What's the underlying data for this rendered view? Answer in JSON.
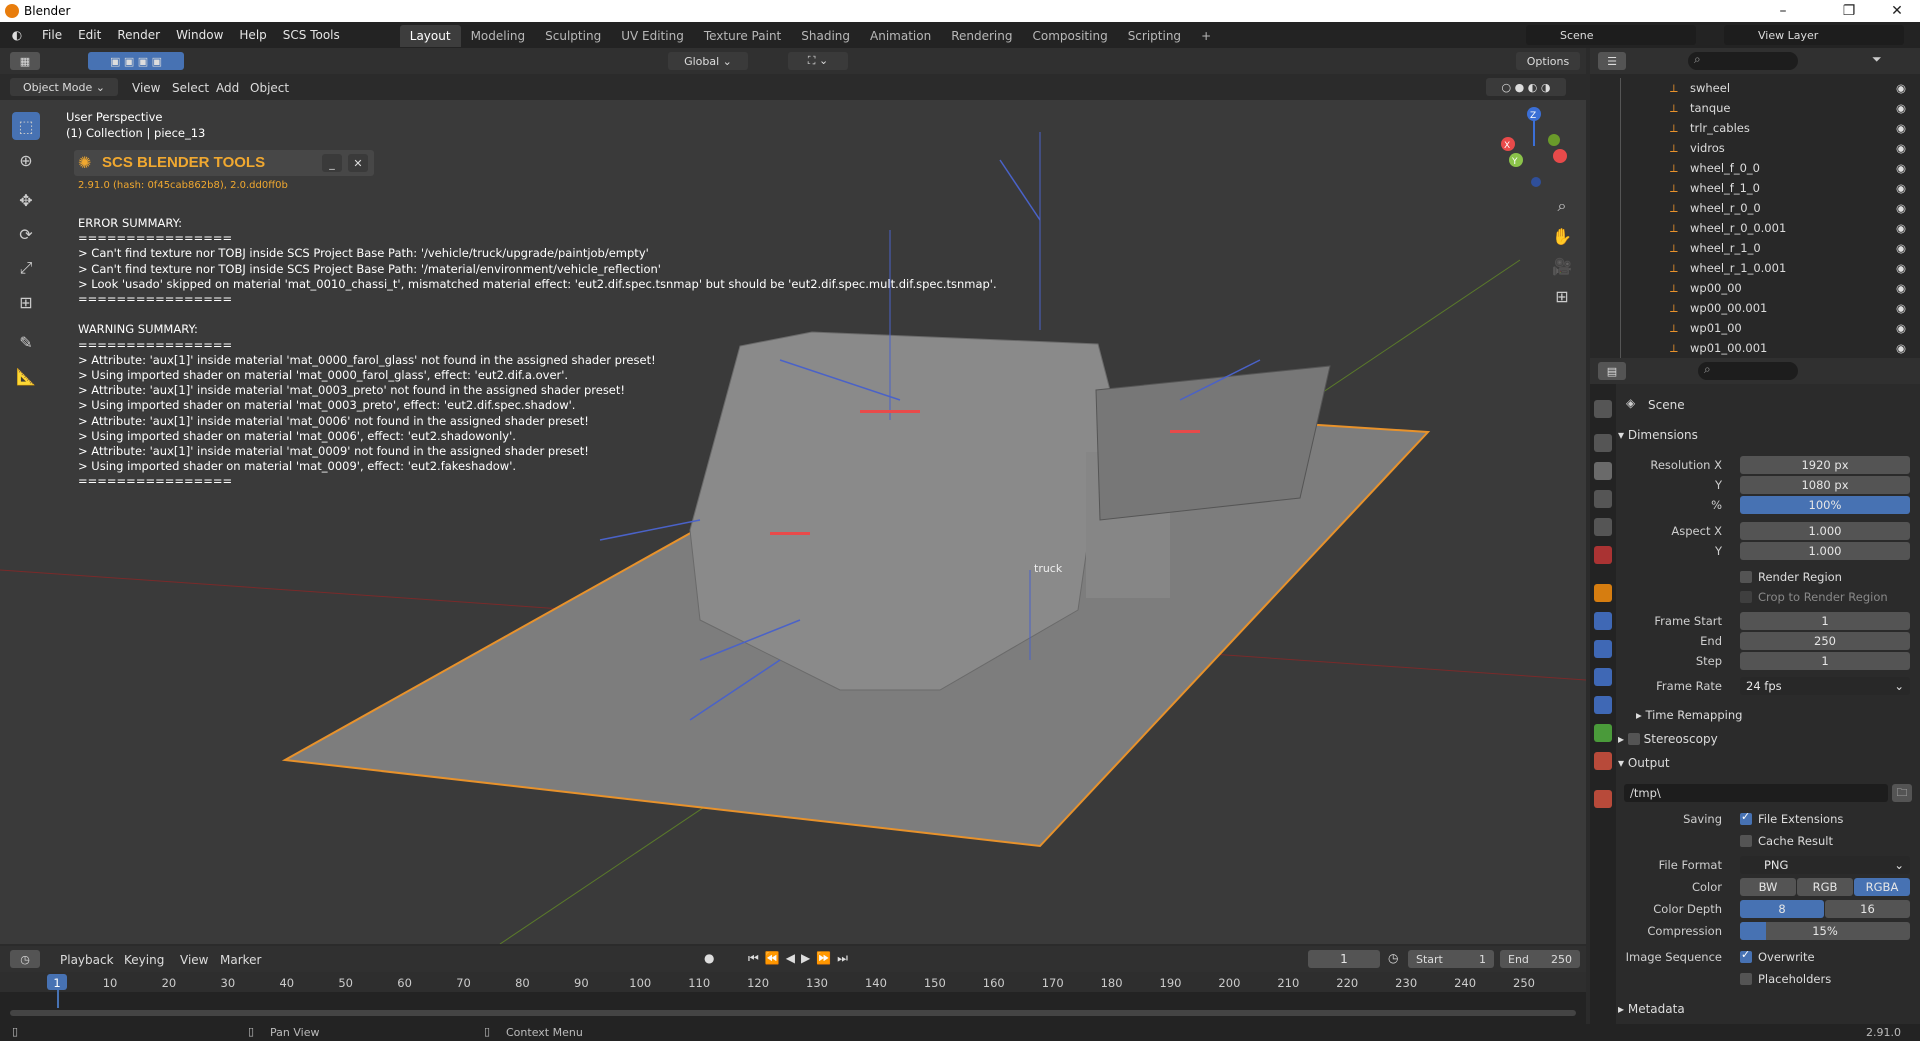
{
  "window": {
    "title": "Blender"
  },
  "menu": [
    "File",
    "Edit",
    "Render",
    "Window",
    "Help",
    "SCS Tools"
  ],
  "workspaces": [
    "Layout",
    "Modeling",
    "Sculpting",
    "UV Editing",
    "Texture Paint",
    "Shading",
    "Animation",
    "Rendering",
    "Compositing",
    "Scripting"
  ],
  "scene_field": "Scene",
  "view_layer_field": "View Layer",
  "viewport": {
    "mode": "Object Mode",
    "menus": [
      "View",
      "Select",
      "Add",
      "Object"
    ],
    "orientation": "Global",
    "options": "Options",
    "perspective": "User Perspective",
    "collection": "(1) Collection | piece_13",
    "object_label": "truck",
    "gizmo": {
      "x": "X",
      "y": "Y",
      "z": "Z"
    }
  },
  "scs": {
    "title": "SCS BLENDER TOOLS",
    "version": "2.91.0 (hash: 0f45cab862b8), 2.0.dd0ff0b",
    "log": "ERROR SUMMARY:\n================\n> Can't find texture nor TOBJ inside SCS Project Base Path: '/vehicle/truck/upgrade/paintjob/empty'\n> Can't find texture nor TOBJ inside SCS Project Base Path: '/material/environment/vehicle_reflection'\n> Look 'usado' skipped on material 'mat_0010_chassi_t', mismatched material effect: 'eut2.dif.spec.tsnmap' but should be 'eut2.dif.spec.mult.dif.spec.tsnmap'.\n================\n\nWARNING SUMMARY:\n================\n> Attribute: 'aux[1]' inside material 'mat_0000_farol_glass' not found in the assigned shader preset!\n> Using imported shader on material 'mat_0000_farol_glass', effect: 'eut2.dif.a.over'.\n> Attribute: 'aux[1]' inside material 'mat_0003_preto' not found in the assigned shader preset!\n> Using imported shader on material 'mat_0003_preto', effect: 'eut2.dif.spec.shadow'.\n> Attribute: 'aux[1]' inside material 'mat_0006' not found in the assigned shader preset!\n> Using imported shader on material 'mat_0006', effect: 'eut2.shadowonly'.\n> Attribute: 'aux[1]' inside material 'mat_0009' not found in the assigned shader preset!\n> Using imported shader on material 'mat_0009', effect: 'eut2.fakeshadow'.\n================"
  },
  "outliner": [
    "swheel",
    "tanque",
    "trlr_cables",
    "vidros",
    "wheel_f_0_0",
    "wheel_f_1_0",
    "wheel_r_0_0",
    "wheel_r_0_0.001",
    "wheel_r_1_0",
    "wheel_r_1_0.001",
    "wp00_00",
    "wp00_00.001",
    "wp01_00",
    "wp01_00.001"
  ],
  "props": {
    "scene": "Scene",
    "dimensions": "Dimensions",
    "res_x_label": "Resolution X",
    "res_x": "1920 px",
    "res_y_label": "Y",
    "res_y": "1080 px",
    "pct_label": "%",
    "pct": "100%",
    "aspect_x_label": "Aspect X",
    "aspect_x": "1.000",
    "aspect_y_label": "Y",
    "aspect_y": "1.000",
    "render_region": "Render Region",
    "crop": "Crop to Render Region",
    "fstart_label": "Frame Start",
    "fstart": "1",
    "fend_label": "End",
    "fend": "250",
    "fstep_label": "Step",
    "fstep": "1",
    "frate_label": "Frame Rate",
    "frate": "24 fps",
    "time_remap": "Time Remapping",
    "stereo": "Stereoscopy",
    "output": "Output",
    "path": "/tmp\\",
    "saving": "Saving",
    "file_ext": "File Extensions",
    "cache": "Cache Result",
    "ffmt_label": "File Format",
    "ffmt": "PNG",
    "color_label": "Color",
    "color_opts": [
      "BW",
      "RGB",
      "RGBA"
    ],
    "depth_label": "Color Depth",
    "depth_opts": [
      "8",
      "16"
    ],
    "comp_label": "Compression",
    "comp": "15%",
    "imgseq_label": "Image Sequence",
    "overwrite": "Overwrite",
    "placeholders": "Placeholders",
    "metadata": "Metadata"
  },
  "timeline": {
    "menus": [
      "Playback",
      "Keying",
      "View",
      "Marker"
    ],
    "current": "1",
    "start_label": "Start",
    "start": "1",
    "end_label": "End",
    "end": "250",
    "ticks": [
      "1",
      "10",
      "20",
      "30",
      "40",
      "50",
      "60",
      "70",
      "80",
      "90",
      "100",
      "110",
      "120",
      "130",
      "140",
      "150",
      "160",
      "170",
      "180",
      "190",
      "200",
      "210",
      "220",
      "230",
      "240",
      "250"
    ]
  },
  "status": {
    "pan": "Pan View",
    "context": "Context Menu",
    "version": "2.91.0"
  }
}
